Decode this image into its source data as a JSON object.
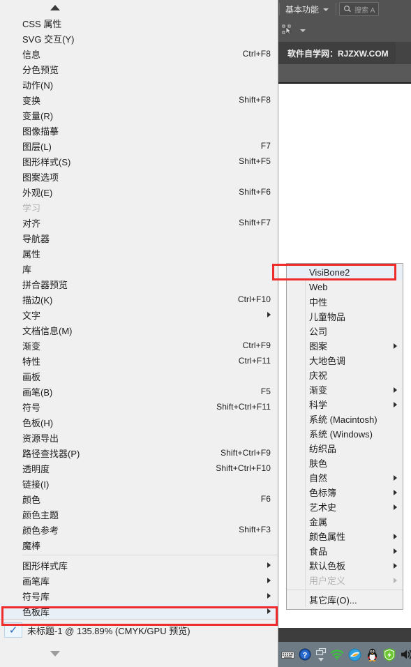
{
  "app": {
    "workspace_label": "基本功能",
    "search_placeholder": "搜索 A",
    "search_icon": "search-icon",
    "workspace_chevron_icon": "chevron-down-icon",
    "tool_icon": "selection-tool-icon",
    "tool_chevron_icon": "chevron-down-icon",
    "document_tab_label": "软件自学网：RJZXW.COM"
  },
  "menu": {
    "scroll_up_icon": "scroll-up-arrow-icon",
    "scroll_down_icon": "scroll-down-arrow-icon",
    "items": [
      {
        "label": "CSS 属性",
        "accel": "",
        "arrow": false,
        "disabled": false
      },
      {
        "label": "SVG 交互(Y)",
        "accel": "",
        "arrow": false,
        "disabled": false
      },
      {
        "label": "信息",
        "accel": "Ctrl+F8",
        "arrow": false,
        "disabled": false
      },
      {
        "label": "分色预览",
        "accel": "",
        "arrow": false,
        "disabled": false
      },
      {
        "label": "动作(N)",
        "accel": "",
        "arrow": false,
        "disabled": false
      },
      {
        "label": "变换",
        "accel": "Shift+F8",
        "arrow": false,
        "disabled": false
      },
      {
        "label": "变量(R)",
        "accel": "",
        "arrow": false,
        "disabled": false
      },
      {
        "label": "图像描摹",
        "accel": "",
        "arrow": false,
        "disabled": false
      },
      {
        "label": "图层(L)",
        "accel": "F7",
        "arrow": false,
        "disabled": false
      },
      {
        "label": "图形样式(S)",
        "accel": "Shift+F5",
        "arrow": false,
        "disabled": false
      },
      {
        "label": "图案选项",
        "accel": "",
        "arrow": false,
        "disabled": false
      },
      {
        "label": "外观(E)",
        "accel": "Shift+F6",
        "arrow": false,
        "disabled": false
      },
      {
        "label": "学习",
        "accel": "",
        "arrow": false,
        "disabled": true
      },
      {
        "label": "对齐",
        "accel": "Shift+F7",
        "arrow": false,
        "disabled": false
      },
      {
        "label": "导航器",
        "accel": "",
        "arrow": false,
        "disabled": false
      },
      {
        "label": "属性",
        "accel": "",
        "arrow": false,
        "disabled": false
      },
      {
        "label": "库",
        "accel": "",
        "arrow": false,
        "disabled": false
      },
      {
        "label": "拼合器预览",
        "accel": "",
        "arrow": false,
        "disabled": false
      },
      {
        "label": "描边(K)",
        "accel": "Ctrl+F10",
        "arrow": false,
        "disabled": false
      },
      {
        "label": "文字",
        "accel": "",
        "arrow": true,
        "disabled": false
      },
      {
        "label": "文档信息(M)",
        "accel": "",
        "arrow": false,
        "disabled": false
      },
      {
        "label": "渐变",
        "accel": "Ctrl+F9",
        "arrow": false,
        "disabled": false
      },
      {
        "label": "特性",
        "accel": "Ctrl+F11",
        "arrow": false,
        "disabled": false
      },
      {
        "label": "画板",
        "accel": "",
        "arrow": false,
        "disabled": false
      },
      {
        "label": "画笔(B)",
        "accel": "F5",
        "arrow": false,
        "disabled": false
      },
      {
        "label": "符号",
        "accel": "Shift+Ctrl+F11",
        "arrow": false,
        "disabled": false
      },
      {
        "label": "色板(H)",
        "accel": "",
        "arrow": false,
        "disabled": false
      },
      {
        "label": "资源导出",
        "accel": "",
        "arrow": false,
        "disabled": false
      },
      {
        "label": "路径查找器(P)",
        "accel": "Shift+Ctrl+F9",
        "arrow": false,
        "disabled": false
      },
      {
        "label": "透明度",
        "accel": "Shift+Ctrl+F10",
        "arrow": false,
        "disabled": false
      },
      {
        "label": "链接(I)",
        "accel": "",
        "arrow": false,
        "disabled": false
      },
      {
        "label": "颜色",
        "accel": "F6",
        "arrow": false,
        "disabled": false
      },
      {
        "label": "颜色主题",
        "accel": "",
        "arrow": false,
        "disabled": false
      },
      {
        "label": "颜色参考",
        "accel": "Shift+F3",
        "arrow": false,
        "disabled": false
      },
      {
        "label": "魔棒",
        "accel": "",
        "arrow": false,
        "disabled": false
      }
    ],
    "library_items": [
      {
        "label": "图形样式库",
        "accel": "",
        "arrow": true,
        "disabled": false,
        "highlighted": false
      },
      {
        "label": "画笔库",
        "accel": "",
        "arrow": true,
        "disabled": false,
        "highlighted": false
      },
      {
        "label": "符号库",
        "accel": "",
        "arrow": true,
        "disabled": false,
        "highlighted": false
      },
      {
        "label": "色板库",
        "accel": "",
        "arrow": true,
        "disabled": false,
        "highlighted": true
      }
    ],
    "document_entry": {
      "label": "未标题-1 @ 135.89% (CMYK/GPU 预览)",
      "checked": true,
      "check_glyph": "✓"
    }
  },
  "submenu": {
    "items": [
      {
        "label": "VisiBone2",
        "arrow": false,
        "disabled": false,
        "highlighted": true
      },
      {
        "label": "Web",
        "arrow": false,
        "disabled": false,
        "highlighted": false
      },
      {
        "label": "中性",
        "arrow": false,
        "disabled": false,
        "highlighted": false
      },
      {
        "label": "儿童物品",
        "arrow": false,
        "disabled": false,
        "highlighted": false
      },
      {
        "label": "公司",
        "arrow": false,
        "disabled": false,
        "highlighted": false
      },
      {
        "label": "图案",
        "arrow": true,
        "disabled": false,
        "highlighted": false
      },
      {
        "label": "大地色调",
        "arrow": false,
        "disabled": false,
        "highlighted": false
      },
      {
        "label": "庆祝",
        "arrow": false,
        "disabled": false,
        "highlighted": false
      },
      {
        "label": "渐变",
        "arrow": true,
        "disabled": false,
        "highlighted": false
      },
      {
        "label": "科学",
        "arrow": true,
        "disabled": false,
        "highlighted": false
      },
      {
        "label": "系统 (Macintosh)",
        "arrow": false,
        "disabled": false,
        "highlighted": false
      },
      {
        "label": "系统 (Windows)",
        "arrow": false,
        "disabled": false,
        "highlighted": false
      },
      {
        "label": "纺织品",
        "arrow": false,
        "disabled": false,
        "highlighted": false
      },
      {
        "label": "肤色",
        "arrow": false,
        "disabled": false,
        "highlighted": false
      },
      {
        "label": "自然",
        "arrow": true,
        "disabled": false,
        "highlighted": false
      },
      {
        "label": "色标簿",
        "arrow": true,
        "disabled": false,
        "highlighted": false
      },
      {
        "label": "艺术史",
        "arrow": true,
        "disabled": false,
        "highlighted": false
      },
      {
        "label": "金属",
        "arrow": false,
        "disabled": false,
        "highlighted": false
      },
      {
        "label": "颜色属性",
        "arrow": true,
        "disabled": false,
        "highlighted": false
      },
      {
        "label": "食品",
        "arrow": true,
        "disabled": false,
        "highlighted": false
      },
      {
        "label": "默认色板",
        "arrow": true,
        "disabled": false,
        "highlighted": false
      },
      {
        "label": "用户定义",
        "arrow": true,
        "disabled": true,
        "highlighted": false
      }
    ],
    "other_item": {
      "label": "其它库(O)...",
      "arrow": false,
      "disabled": false,
      "highlighted": false
    }
  },
  "taskbar": {
    "icons": [
      "keyboard-icon",
      "help-question-icon",
      "show-hidden-icons-icon",
      "wifi-icon",
      "browser-icon",
      "qq-penguin-icon",
      "security-shield-icon",
      "volume-speaker-icon"
    ]
  },
  "annotations": {
    "color": "#ef2b2b",
    "boxes": [
      "swatch-libraries-highlight",
      "visibone2-highlight"
    ]
  }
}
